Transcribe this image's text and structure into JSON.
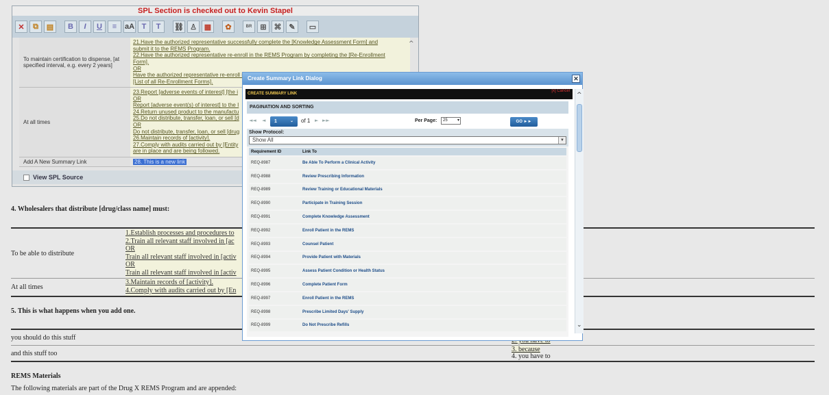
{
  "editor": {
    "title": "SPL Section is checked out to Kevin Stapel",
    "toolbar": [
      {
        "name": "cut-icon",
        "glyph": "✕"
      },
      {
        "name": "copy-icon",
        "glyph": "⧉"
      },
      {
        "name": "paste-icon",
        "glyph": "▤"
      },
      {
        "name": "bold-button",
        "glyph": "B"
      },
      {
        "name": "italic-button",
        "glyph": "I"
      },
      {
        "name": "underline-button",
        "glyph": "U"
      },
      {
        "name": "format-icon",
        "glyph": "≡"
      },
      {
        "name": "case-icon",
        "glyph": "aA"
      },
      {
        "name": "superscript-button",
        "glyph": "T"
      },
      {
        "name": "subscript-button",
        "glyph": "T"
      },
      {
        "name": "link-icon",
        "glyph": "⛓"
      },
      {
        "name": "person-icon",
        "glyph": "♙"
      },
      {
        "name": "image-icon",
        "glyph": "▦"
      },
      {
        "name": "special-icon",
        "glyph": "✿"
      },
      {
        "name": "br-button",
        "glyph": "BR"
      },
      {
        "name": "table-icon",
        "glyph": "⊞"
      },
      {
        "name": "tag-icon",
        "glyph": "⌘"
      },
      {
        "name": "edit-icon",
        "glyph": "✎"
      },
      {
        "name": "comment-icon",
        "glyph": "▭"
      }
    ],
    "rows": [
      {
        "condition": "To maintain certification to dispense, [at specified interval, e.g. every 2 years]",
        "items": [
          "21.Have the authorized representative successfully complete the [Knowledge Assessment Form] and",
          "submit it to the REMS Program.",
          "22.Have the authorized representative re-enroll in the REMS Program by completing the [Re-Enrollment",
          "Form].",
          "OR",
          "Have the authorized representative re-enroll in the REMS Program by completing the applicable form(s):",
          "[List of all Re-Enrollment Forms]."
        ]
      },
      {
        "condition": "At all times",
        "items": [
          "23.Report [adverse events of interest] [the i",
          "OR",
          "Report [adverse event(s) of interest] to the I",
          "24.Return unused product to the manufactu",
          "25.Do not distribute, transfer, loan, or sell [d",
          "OR",
          "Do not distribute, transfer, loan, or sell [drug",
          "26.Maintain records of [activity].",
          "27.Comply with audits carried out by [Entity",
          "are in place and are being followed."
        ]
      },
      {
        "condition": "Add A New Summary Link",
        "items": [
          "28. This is a new link"
        ]
      }
    ],
    "view_source_label": "View SPL Source"
  },
  "doc": {
    "section4_heading": "4. Wholesalers that distribute [drug/class name] must:",
    "row1_label": "To be able to distribute",
    "row1_items": [
      "1.Establish processes and procedures to",
      "2.Train all relevant staff involved in [ac",
      "OR",
      "Train all relevant staff involved in [activ",
      "OR",
      "Train all relevant staff involved in [activ"
    ],
    "row2_label": "At all times",
    "row2_items": [
      "3.Maintain records of [activity].",
      "4.Comply with audits carried out by [En"
    ],
    "section5_heading": "5. This is what happens when you add one.",
    "row3_label": "you should do this stuff",
    "row3_right": "2. you have to",
    "row4_label": "and this stuff too",
    "row4_right": [
      "3. because",
      "4. you have to"
    ],
    "rems_heading": "REMS Materials",
    "rems_text": "The following materials are part of the Drug X REMS Program and are appended:"
  },
  "dialog": {
    "title": "Create Summary Link Dialog",
    "close_glyph": "✕",
    "header_bar": "CREATE SUMMARY LINK",
    "cancel_label": "[x] Cancel",
    "pagination_heading": "PAGINATION AND SORTING",
    "page_value": "1",
    "of_text": "of 1",
    "per_page_label": "Per Page:",
    "per_page_value": "25",
    "go_label": "GO ►►",
    "show_protocol_label": "Show Protocol:",
    "show_protocol_value": "Show All",
    "columns": [
      "Requirement ID",
      "Link To"
    ],
    "rows": [
      {
        "id": "REQ-8987",
        "link": "Be Able To Perform a Clinical Activity"
      },
      {
        "id": "REQ-8988",
        "link": "Review Prescribing Information"
      },
      {
        "id": "REQ-8989",
        "link": "Review Training or Educational Materials"
      },
      {
        "id": "REQ-8990",
        "link": "Participate in Training Session"
      },
      {
        "id": "REQ-8991",
        "link": "Complete Knowledge Assessment"
      },
      {
        "id": "REQ-8992",
        "link": "Enroll Patient in the REMS"
      },
      {
        "id": "REQ-8993",
        "link": "Counsel Patient"
      },
      {
        "id": "REQ-8994",
        "link": "Provide Patient with Materials"
      },
      {
        "id": "REQ-8995",
        "link": "Assess Patient Condition or Health Status"
      },
      {
        "id": "REQ-8996",
        "link": "Complete Patient Form"
      },
      {
        "id": "REQ-8997",
        "link": "Enroll Patient in the REMS"
      },
      {
        "id": "REQ-8998",
        "link": "Prescribe Limited Days' Supply"
      },
      {
        "id": "REQ-8999",
        "link": "Do Not Prescribe Refills"
      }
    ]
  }
}
